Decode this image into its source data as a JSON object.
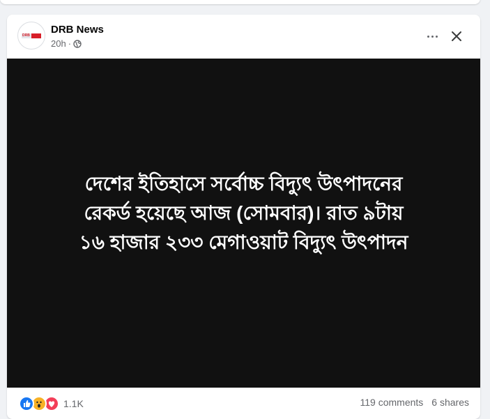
{
  "post": {
    "page_name": "DRB News",
    "time": "20h",
    "separator": "·",
    "logo_text": "DRB",
    "media_text_lines": [
      "দেশের ইতিহাসে সর্বোচ্চ বিদ্যুৎ উৎপাদনের",
      "রেকর্ড হয়েছে আজ (সোমবার)। রাত ৯টায়",
      "১৬ হাজার ২৩৩ মেগাওয়াট বিদ্যুৎ উৎপাদন"
    ],
    "reaction_count": "1.1K",
    "comments": "119 comments",
    "shares": "6 shares"
  },
  "icons": {
    "privacy": "globe-icon",
    "more": "more-options-icon",
    "close": "close-icon",
    "reactions": [
      "like-icon",
      "wow-icon",
      "love-icon"
    ]
  },
  "colors": {
    "accent": "#1877f2",
    "media_background": "#111111",
    "meta_text": "#65676b"
  }
}
